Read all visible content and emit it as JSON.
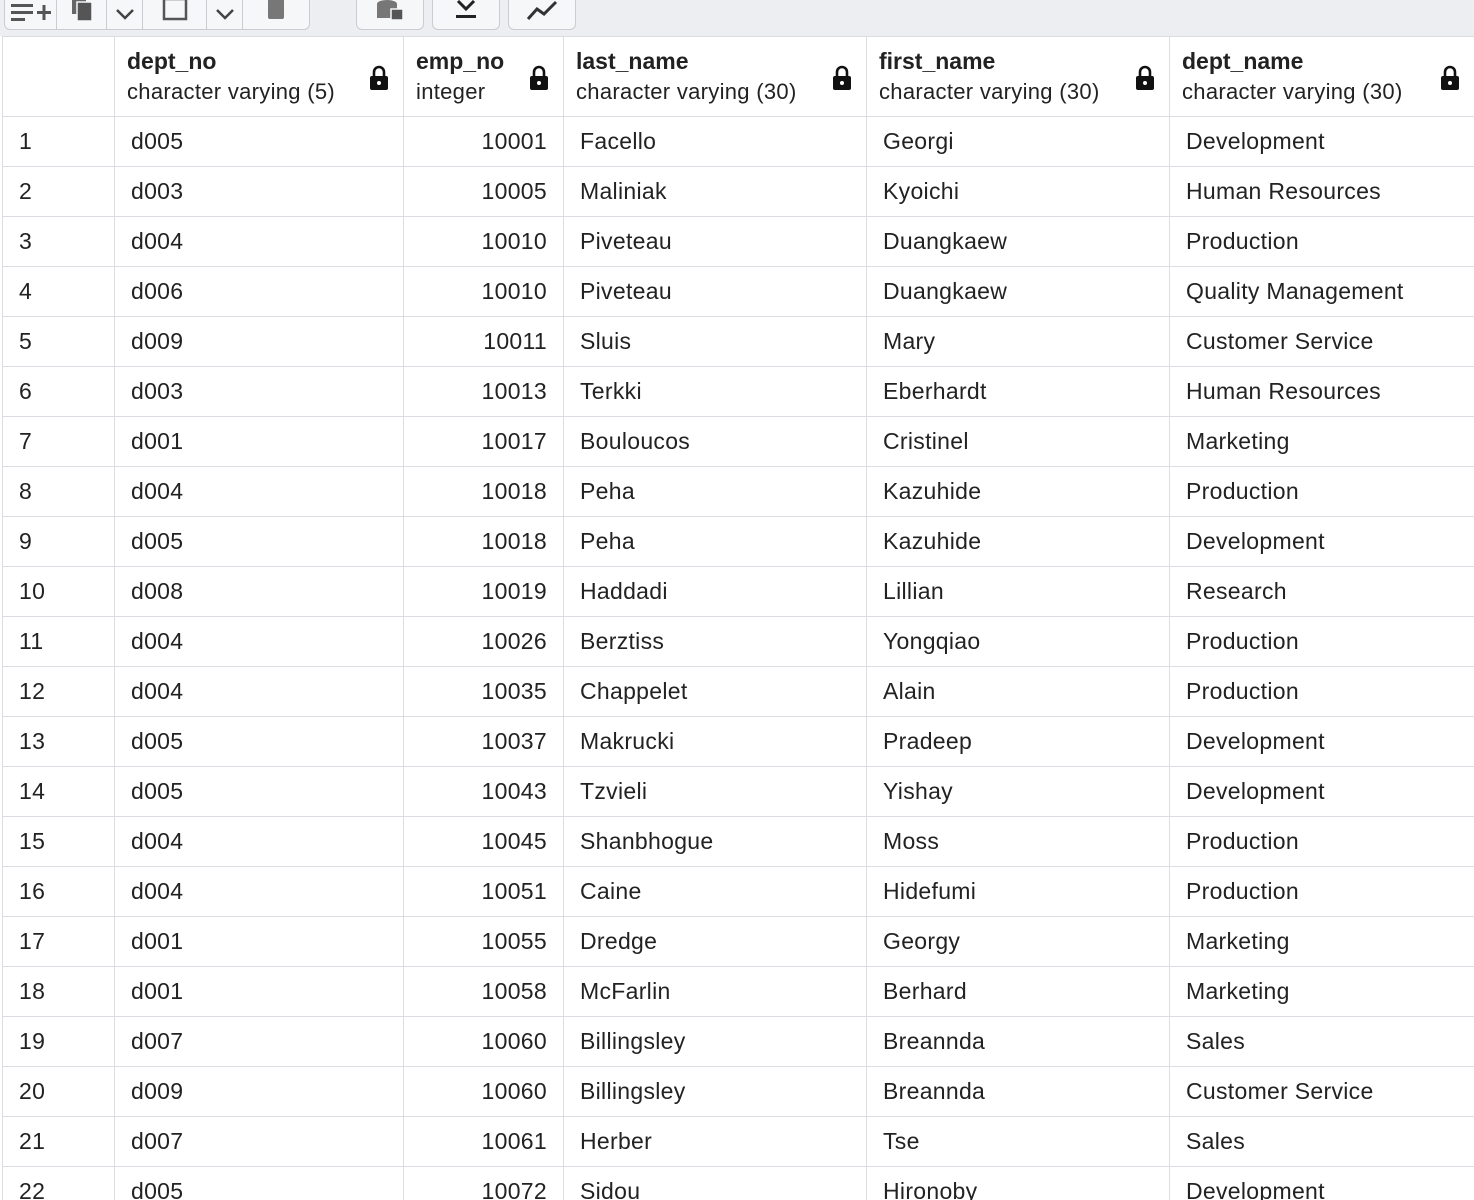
{
  "toolbar": {
    "icons": [
      "add-row-icon",
      "copy-icon",
      "chevron-down-icon",
      "paste-icon",
      "chevron-down-icon",
      "delete-icon",
      "save-data-icon",
      "download-icon",
      "graph-icon"
    ]
  },
  "grid": {
    "columns": [
      {
        "name": "dept_no",
        "type": "character varying (5)",
        "locked": true
      },
      {
        "name": "emp_no",
        "type": "integer",
        "locked": true
      },
      {
        "name": "last_name",
        "type": "character varying (30)",
        "locked": true
      },
      {
        "name": "first_name",
        "type": "character varying (30)",
        "locked": true
      },
      {
        "name": "dept_name",
        "type": "character varying (30)",
        "locked": true
      }
    ],
    "rows": [
      [
        "1",
        "d005",
        "10001",
        "Facello",
        "Georgi",
        "Development"
      ],
      [
        "2",
        "d003",
        "10005",
        "Maliniak",
        "Kyoichi",
        "Human Resources"
      ],
      [
        "3",
        "d004",
        "10010",
        "Piveteau",
        "Duangkaew",
        "Production"
      ],
      [
        "4",
        "d006",
        "10010",
        "Piveteau",
        "Duangkaew",
        "Quality Management"
      ],
      [
        "5",
        "d009",
        "10011",
        "Sluis",
        "Mary",
        "Customer Service"
      ],
      [
        "6",
        "d003",
        "10013",
        "Terkki",
        "Eberhardt",
        "Human Resources"
      ],
      [
        "7",
        "d001",
        "10017",
        "Bouloucos",
        "Cristinel",
        "Marketing"
      ],
      [
        "8",
        "d004",
        "10018",
        "Peha",
        "Kazuhide",
        "Production"
      ],
      [
        "9",
        "d005",
        "10018",
        "Peha",
        "Kazuhide",
        "Development"
      ],
      [
        "10",
        "d008",
        "10019",
        "Haddadi",
        "Lillian",
        "Research"
      ],
      [
        "11",
        "d004",
        "10026",
        "Berztiss",
        "Yongqiao",
        "Production"
      ],
      [
        "12",
        "d004",
        "10035",
        "Chappelet",
        "Alain",
        "Production"
      ],
      [
        "13",
        "d005",
        "10037",
        "Makrucki",
        "Pradeep",
        "Development"
      ],
      [
        "14",
        "d005",
        "10043",
        "Tzvieli",
        "Yishay",
        "Development"
      ],
      [
        "15",
        "d004",
        "10045",
        "Shanbhogue",
        "Moss",
        "Production"
      ],
      [
        "16",
        "d004",
        "10051",
        "Caine",
        "Hidefumi",
        "Production"
      ],
      [
        "17",
        "d001",
        "10055",
        "Dredge",
        "Georgy",
        "Marketing"
      ],
      [
        "18",
        "d001",
        "10058",
        "McFarlin",
        "Berhard",
        "Marketing"
      ],
      [
        "19",
        "d007",
        "10060",
        "Billingsley",
        "Breannda",
        "Sales"
      ],
      [
        "20",
        "d009",
        "10060",
        "Billingsley",
        "Breannda",
        "Customer Service"
      ],
      [
        "21",
        "d007",
        "10061",
        "Herber",
        "Tse",
        "Sales"
      ],
      [
        "22",
        "d005",
        "10072",
        "Sidou",
        "Hironoby",
        "Development"
      ]
    ]
  }
}
